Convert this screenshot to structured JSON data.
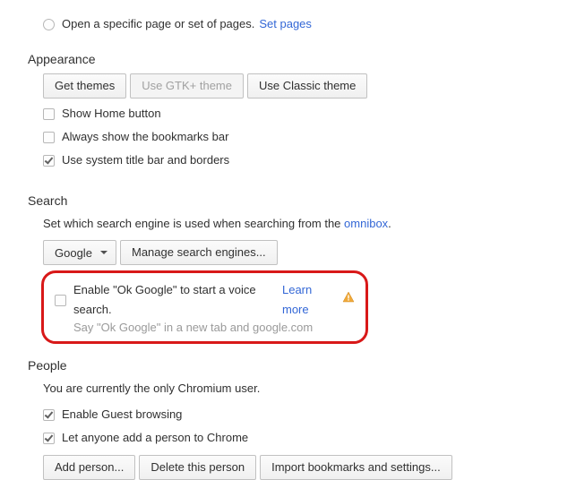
{
  "startup": {
    "open_pages_label": "Open a specific page or set of pages.",
    "set_pages_link": "Set pages"
  },
  "appearance": {
    "title": "Appearance",
    "get_themes": "Get themes",
    "gtk_theme": "Use GTK+ theme",
    "classic_theme": "Use Classic theme",
    "show_home": "Show Home button",
    "show_bookmarks": "Always show the bookmarks bar",
    "system_titlebar": "Use system title bar and borders"
  },
  "search": {
    "title": "Search",
    "desc_prefix": "Set which search engine is used when searching from the ",
    "omnibox_link": "omnibox",
    "desc_suffix": ".",
    "selected_engine": "Google",
    "manage_engines": "Manage search engines...",
    "ok_google_label": "Enable \"Ok Google\" to start a voice search.",
    "learn_more": "Learn more",
    "ok_google_hint": "Say \"Ok Google\" in a new tab and google.com"
  },
  "people": {
    "title": "People",
    "only_user": "You are currently the only Chromium user.",
    "guest_browsing": "Enable Guest browsing",
    "let_anyone_add": "Let anyone add a person to Chrome",
    "add_person": "Add person...",
    "delete_person": "Delete this person",
    "import_bookmarks": "Import bookmarks and settings..."
  }
}
